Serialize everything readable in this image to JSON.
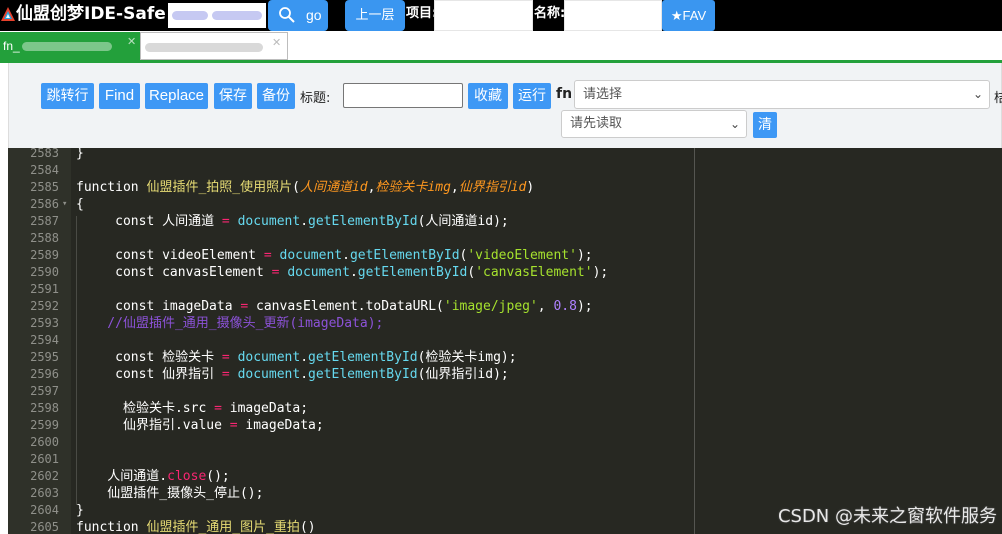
{
  "topbar": {
    "app_title": "仙盟创梦IDE-Safe",
    "go_label": "go",
    "up_label": "上一层",
    "project_label": "项目:",
    "name_label": "名称:",
    "fav_label": "★FAV"
  },
  "tabs": [
    {
      "label": "fn_",
      "active": true
    },
    {
      "label": "",
      "active": false
    }
  ],
  "toolbar": {
    "jump_label": "跳转行",
    "find_label": "Find",
    "replace_label": "Replace",
    "save_label": "保存",
    "backup_label": "备份",
    "title_label": "标题:",
    "collect_label": "收藏",
    "run_label": "运行",
    "fn_label": "fn",
    "select1_value": "请选择",
    "select2_value": "请先读取",
    "clear_label": "清",
    "cutoff_label": "桔"
  },
  "editor": {
    "lines": [
      {
        "num": "2583",
        "fold": "",
        "tokens": [
          [
            "t",
            "}"
          ]
        ]
      },
      {
        "num": "2584",
        "fold": "",
        "tokens": []
      },
      {
        "num": "2585",
        "fold": "",
        "tokens": [
          [
            "k",
            "function "
          ],
          [
            "fn",
            "仙盟插件_拍照_使用照片"
          ],
          [
            "t",
            "("
          ],
          [
            "p",
            "人间通道id"
          ],
          [
            "t",
            ","
          ],
          [
            "p",
            "检验关卡img"
          ],
          [
            "t",
            ","
          ],
          [
            "p",
            "仙界指引id"
          ],
          [
            "t",
            ")"
          ]
        ]
      },
      {
        "num": "2586",
        "fold": "▾",
        "tokens": [
          [
            "t",
            "{"
          ]
        ]
      },
      {
        "num": "2587",
        "fold": "",
        "tokens": [
          [
            "t",
            "     const 人间通道 "
          ],
          [
            "o",
            "="
          ],
          [
            "t",
            " "
          ],
          [
            "m",
            "document"
          ],
          [
            "t",
            "."
          ],
          [
            "m",
            "getElementById"
          ],
          [
            "t",
            "(人间通道id);"
          ]
        ]
      },
      {
        "num": "2588",
        "fold": "",
        "tokens": []
      },
      {
        "num": "2589",
        "fold": "",
        "tokens": [
          [
            "t",
            "     const videoElement "
          ],
          [
            "o",
            "="
          ],
          [
            "t",
            " "
          ],
          [
            "m",
            "document"
          ],
          [
            "t",
            "."
          ],
          [
            "m",
            "getElementById"
          ],
          [
            "t",
            "("
          ],
          [
            "s",
            "'videoElement'"
          ],
          [
            "t",
            ");"
          ]
        ]
      },
      {
        "num": "2590",
        "fold": "",
        "tokens": [
          [
            "t",
            "     const canvasElement "
          ],
          [
            "o",
            "="
          ],
          [
            "t",
            " "
          ],
          [
            "m",
            "document"
          ],
          [
            "t",
            "."
          ],
          [
            "m",
            "getElementById"
          ],
          [
            "t",
            "("
          ],
          [
            "s",
            "'canvasElement'"
          ],
          [
            "t",
            ");"
          ]
        ]
      },
      {
        "num": "2591",
        "fold": "",
        "tokens": []
      },
      {
        "num": "2592",
        "fold": "",
        "tokens": [
          [
            "t",
            "     const imageData "
          ],
          [
            "o",
            "="
          ],
          [
            "t",
            " canvasElement.toDataURL("
          ],
          [
            "s",
            "'image/jpeg'"
          ],
          [
            "t",
            ", "
          ],
          [
            "n",
            "0.8"
          ],
          [
            "t",
            ");"
          ]
        ]
      },
      {
        "num": "2593",
        "fold": "",
        "tokens": [
          [
            "c",
            "    //仙盟插件_通用_摄像头_更新(imageData);"
          ]
        ]
      },
      {
        "num": "2594",
        "fold": "",
        "tokens": []
      },
      {
        "num": "2595",
        "fold": "",
        "tokens": [
          [
            "t",
            "     const 检验关卡 "
          ],
          [
            "o",
            "="
          ],
          [
            "t",
            " "
          ],
          [
            "m",
            "document"
          ],
          [
            "t",
            "."
          ],
          [
            "m",
            "getElementById"
          ],
          [
            "t",
            "(检验关卡img);"
          ]
        ]
      },
      {
        "num": "2596",
        "fold": "",
        "tokens": [
          [
            "t",
            "     const 仙界指引 "
          ],
          [
            "o",
            "="
          ],
          [
            "t",
            " "
          ],
          [
            "m",
            "document"
          ],
          [
            "t",
            "."
          ],
          [
            "m",
            "getElementById"
          ],
          [
            "t",
            "(仙界指引id);"
          ]
        ]
      },
      {
        "num": "2597",
        "fold": "",
        "tokens": []
      },
      {
        "num": "2598",
        "fold": "",
        "tokens": [
          [
            "t",
            "      检验关卡.src "
          ],
          [
            "o",
            "="
          ],
          [
            "t",
            " imageData;"
          ]
        ]
      },
      {
        "num": "2599",
        "fold": "",
        "tokens": [
          [
            "t",
            "      仙界指引.value "
          ],
          [
            "o",
            "="
          ],
          [
            "t",
            " imageData;"
          ]
        ]
      },
      {
        "num": "2600",
        "fold": "",
        "tokens": []
      },
      {
        "num": "2601",
        "fold": "",
        "tokens": []
      },
      {
        "num": "2602",
        "fold": "",
        "tokens": [
          [
            "t",
            "    人间通道."
          ],
          [
            "o",
            "close"
          ],
          [
            "t",
            "();"
          ]
        ]
      },
      {
        "num": "2603",
        "fold": "",
        "tokens": [
          [
            "t",
            "    仙盟插件_摄像头_停止();"
          ]
        ]
      },
      {
        "num": "2604",
        "fold": "",
        "tokens": [
          [
            "t",
            "}"
          ]
        ]
      },
      {
        "num": "2605",
        "fold": "",
        "tokens": [
          [
            "k",
            "function "
          ],
          [
            "fn",
            "仙盟插件_通用_图片_重拍"
          ],
          [
            "t",
            "()"
          ]
        ]
      }
    ]
  },
  "watermark": "CSDN @未来之窗软件服务",
  "colors": {
    "topbar_bg": "#000000",
    "button_blue": "#3a96f0",
    "tab_green": "#23a03b",
    "editor_bg": "#272822",
    "gutter_bg": "#2f3129"
  }
}
